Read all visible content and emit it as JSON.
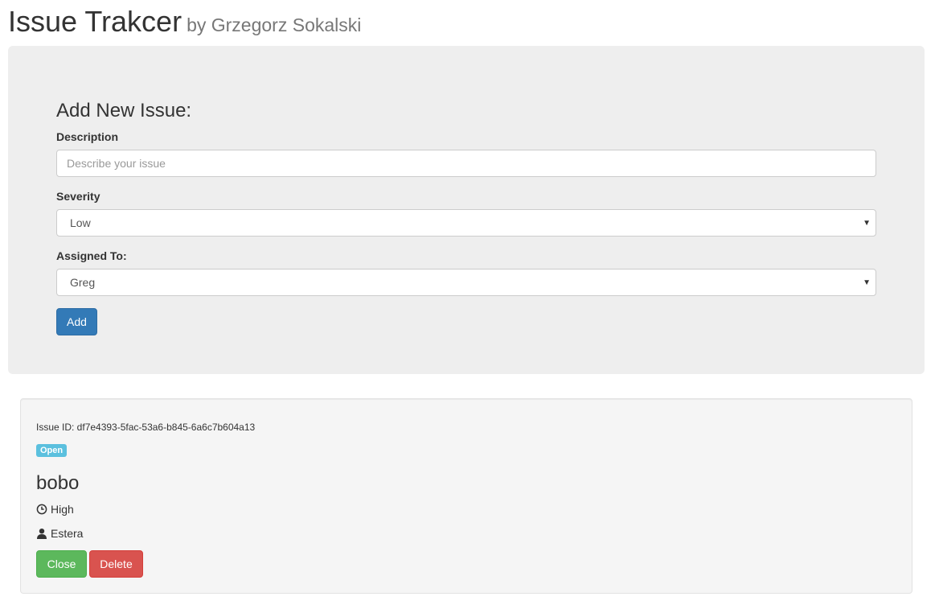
{
  "header": {
    "title": "Issue Trakcer",
    "subtitle": "by Grzegorz Sokalski"
  },
  "form": {
    "title": "Add New Issue:",
    "description_label": "Description",
    "description_placeholder": "Describe your issue",
    "description_value": "",
    "severity_label": "Severity",
    "severity_value": "Low",
    "assigned_label": "Assigned To:",
    "assigned_value": "Greg",
    "add_label": "Add"
  },
  "issues": [
    {
      "id_text": "Issue ID: df7e4393-5fac-53a6-b845-6a6c7b604a13",
      "status": "Open",
      "description": "bobo",
      "severity": "High",
      "assignee": "Estera",
      "close_label": "Close",
      "delete_label": "Delete"
    }
  ],
  "icons": {
    "severity": "clock-icon",
    "assignee": "user-icon"
  },
  "colors": {
    "primary": "#337ab7",
    "success": "#5cb85c",
    "danger": "#d9534f",
    "info": "#5bc0de",
    "jumbotron_bg": "#eeeeee",
    "well_bg": "#f5f5f5"
  }
}
